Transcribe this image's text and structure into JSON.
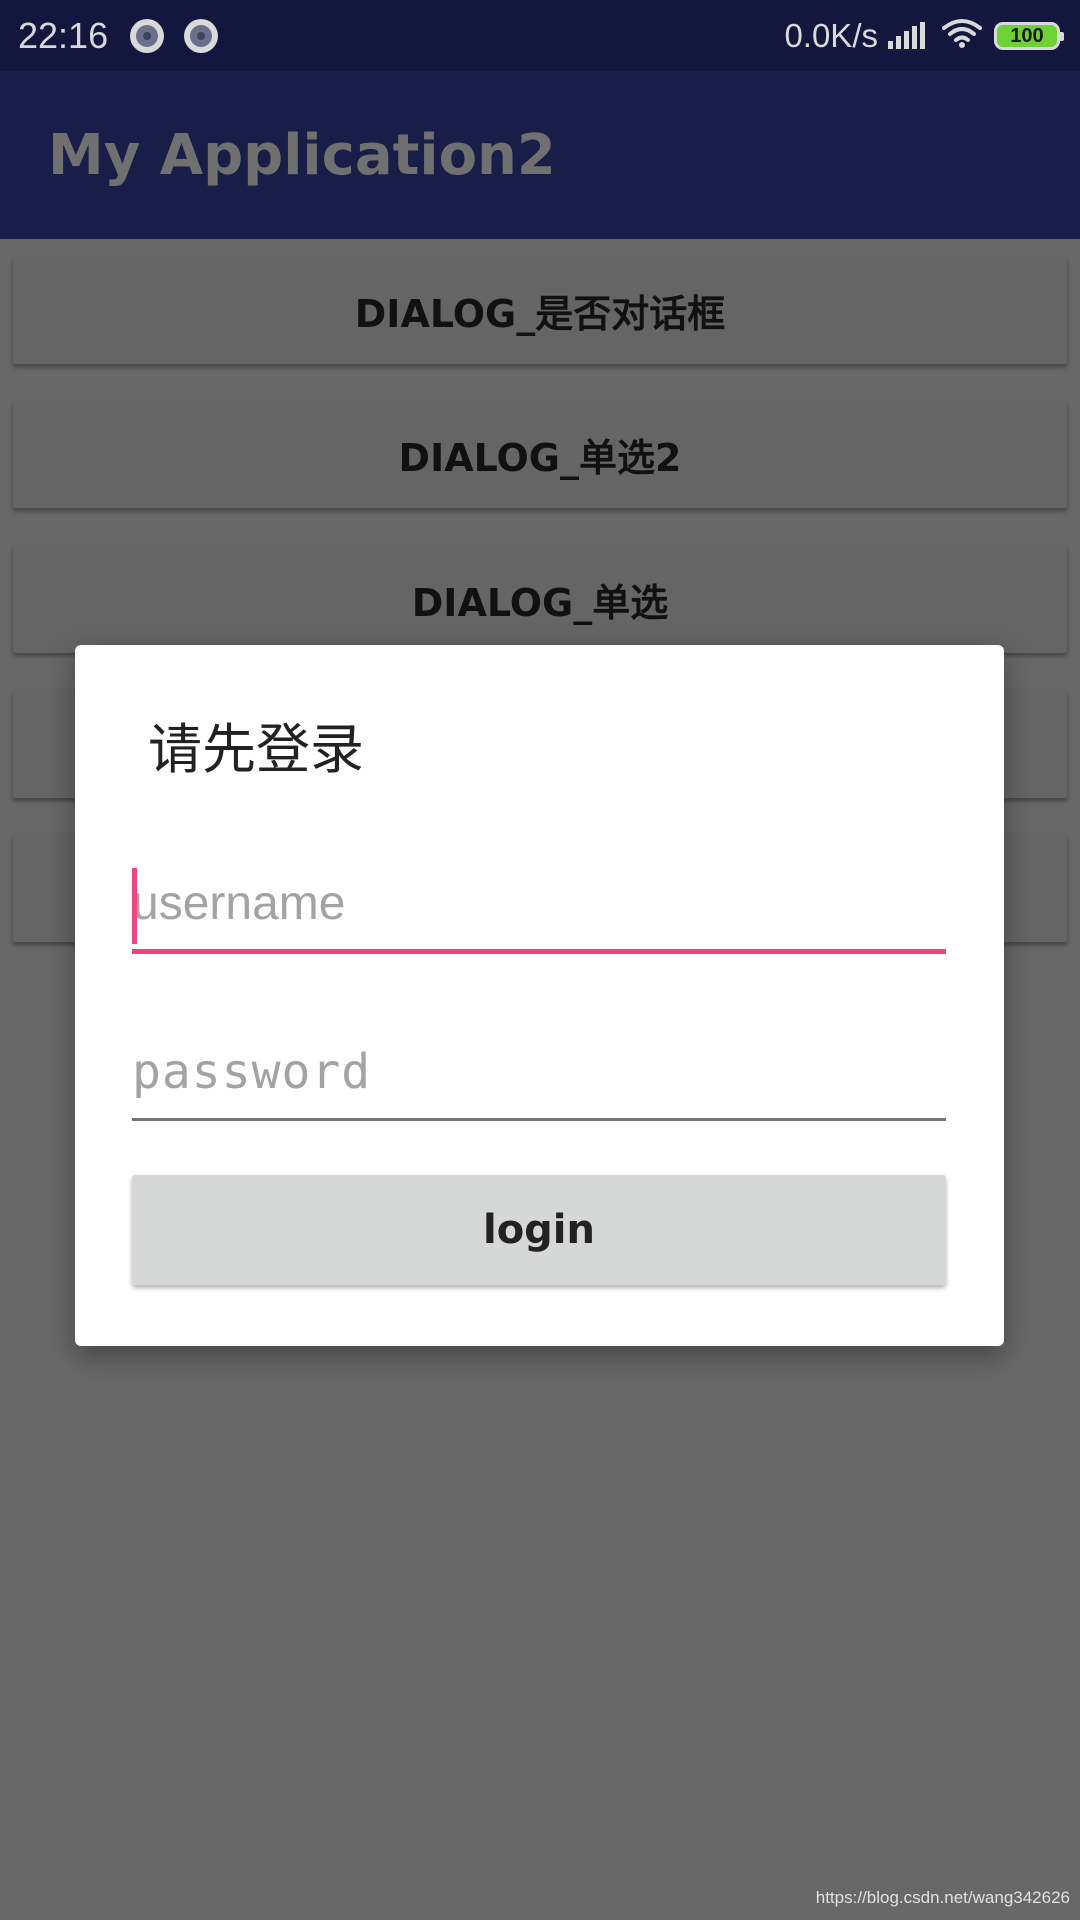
{
  "status_bar": {
    "time": "22:16",
    "notification_icons": [
      "notification-dot-icon",
      "notification-dot-icon"
    ],
    "network_speed": "0.0K/s",
    "signal_icon": "cell-signal-icon",
    "wifi_icon": "wifi-icon",
    "battery_level": "100",
    "battery_color": "#6cd235"
  },
  "app_bar": {
    "title": "My Application2",
    "background_color": "#181e47"
  },
  "background_buttons": [
    {
      "label": "DIALOG_是否对话框"
    },
    {
      "label": "DIALOG_单选2"
    },
    {
      "label": "DIALOG_单选"
    },
    {
      "label": ""
    },
    {
      "label": ""
    }
  ],
  "dialog": {
    "title": "请先登录",
    "username": {
      "value": "",
      "placeholder": "username"
    },
    "password": {
      "value": "",
      "placeholder": "password"
    },
    "login_label": "login",
    "accent_color": "#f0457a"
  },
  "watermark": "https://blog.csdn.net/wang342626"
}
